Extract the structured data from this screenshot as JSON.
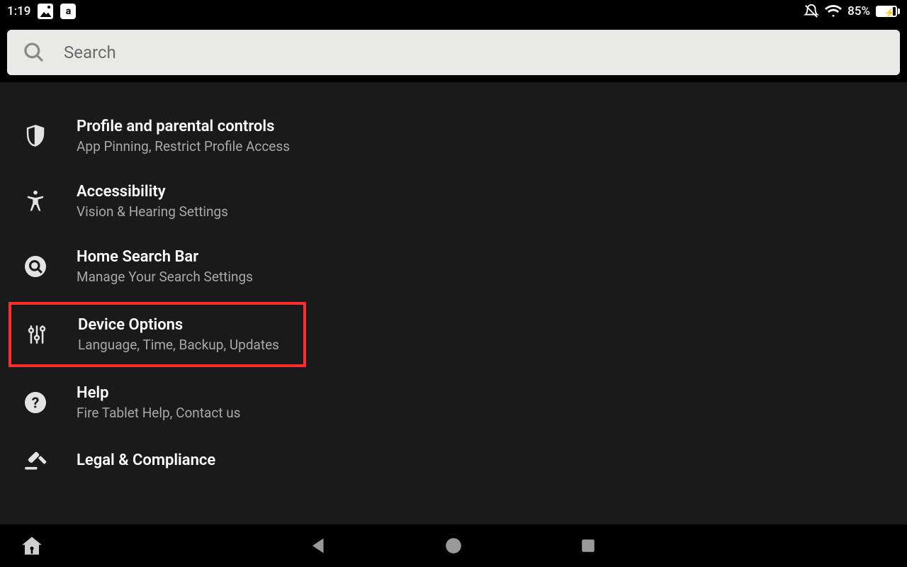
{
  "status_bar": {
    "time": "1:19",
    "battery_pct": "85%"
  },
  "search": {
    "placeholder": "Search"
  },
  "settings": [
    {
      "id": "profile",
      "icon": "shield",
      "title": "Profile and parental controls",
      "sub": "App Pinning, Restrict Profile Access"
    },
    {
      "id": "accessibility",
      "icon": "accessibility",
      "title": "Accessibility",
      "sub": "Vision & Hearing Settings"
    },
    {
      "id": "home-search",
      "icon": "search-circle",
      "title": "Home Search Bar",
      "sub": "Manage Your Search Settings"
    },
    {
      "id": "device",
      "icon": "sliders",
      "title": "Device Options",
      "sub": "Language, Time, Backup, Updates",
      "highlighted": true
    },
    {
      "id": "help",
      "icon": "question",
      "title": "Help",
      "sub": "Fire Tablet Help, Contact us"
    },
    {
      "id": "legal",
      "icon": "gavel",
      "title": "Legal & Compliance",
      "sub": ""
    }
  ],
  "highlight_color": "#ff2e2e"
}
